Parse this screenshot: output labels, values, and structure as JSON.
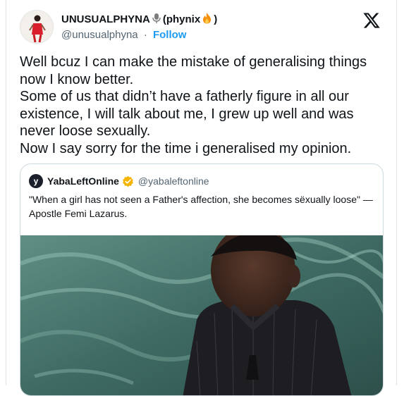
{
  "author": {
    "display_name": "UNUSUALPHYNA",
    "name_suffix": "(phynix",
    "name_close": ")",
    "handle": "@unusualphyna",
    "separator": "·",
    "follow_label": "Follow"
  },
  "tweet": {
    "text": "Well bcuz I can make the mistake of generalising things now I know better.\nSome of us that didn’t have a fatherly figure in all our existence, I will talk about me, I grew up well and was never loose sexually.\nNow I say sorry for the time i generalised my opinion."
  },
  "quote": {
    "avatar_letter": "y",
    "display_name": "YabaLeftOnline",
    "handle": "@yabaleftonline",
    "text": "\"When a girl has not seen a Father's affection, she becomes sëxually loose\" — Apostle Femi Lazarus."
  },
  "icons": {
    "logo": "x-logo-icon",
    "mic": "microphone-icon",
    "fire": "fire-icon",
    "verified": "verified-badge-icon"
  },
  "colors": {
    "link": "#1d9bf0",
    "verified": "#f4b400",
    "secondary_text": "#536471"
  }
}
